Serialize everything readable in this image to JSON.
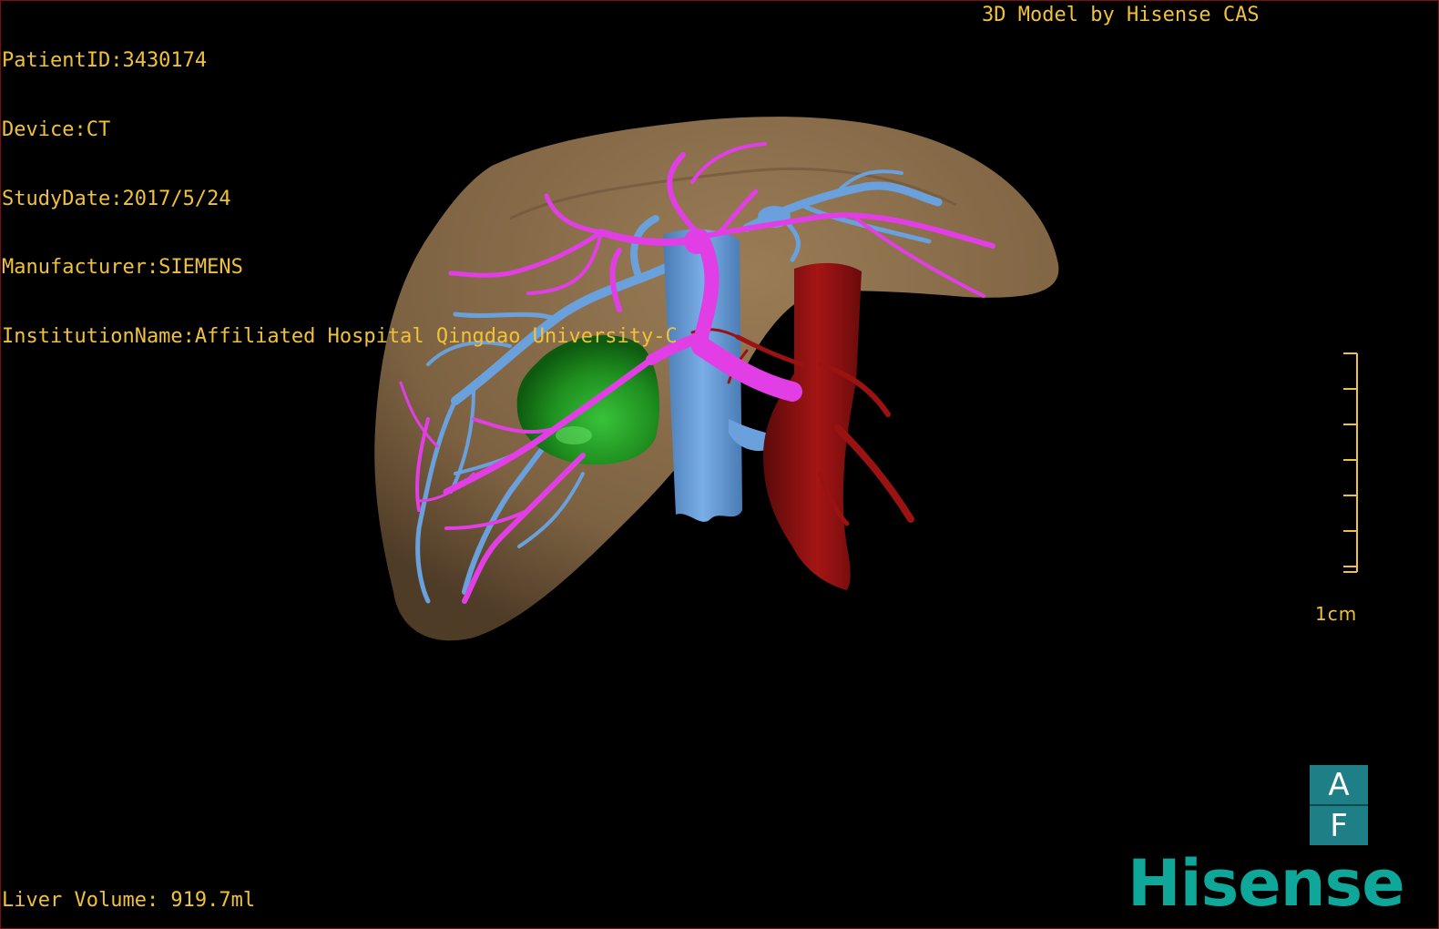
{
  "overlay": {
    "patient_id": "PatientID:3430174",
    "device": "Device:CT",
    "study_date": "StudyDate:2017/5/24",
    "manufacturer": "Manufacturer:SIEMENS",
    "institution": "InstitutionName:Affiliated Hospital Qingdao University-C",
    "model_label": "3D Model by Hisense CAS",
    "liver_volume": "Liver Volume: 919.7ml"
  },
  "scale": {
    "label": "1cm",
    "color": "#f0c23a"
  },
  "orientation": {
    "top_letter": "A",
    "bottom_letter": "F",
    "color": "#1f7f86"
  },
  "brand": {
    "name": "Hisense",
    "color": "#0fa79a"
  },
  "structures": {
    "liver_color": "#8a6d4a",
    "portal_vein_color": "#e23ee6",
    "hepatic_vein_color": "#6aa0dc",
    "tumor_color": "#1f8f1f",
    "artery_color": "#9a1212"
  }
}
